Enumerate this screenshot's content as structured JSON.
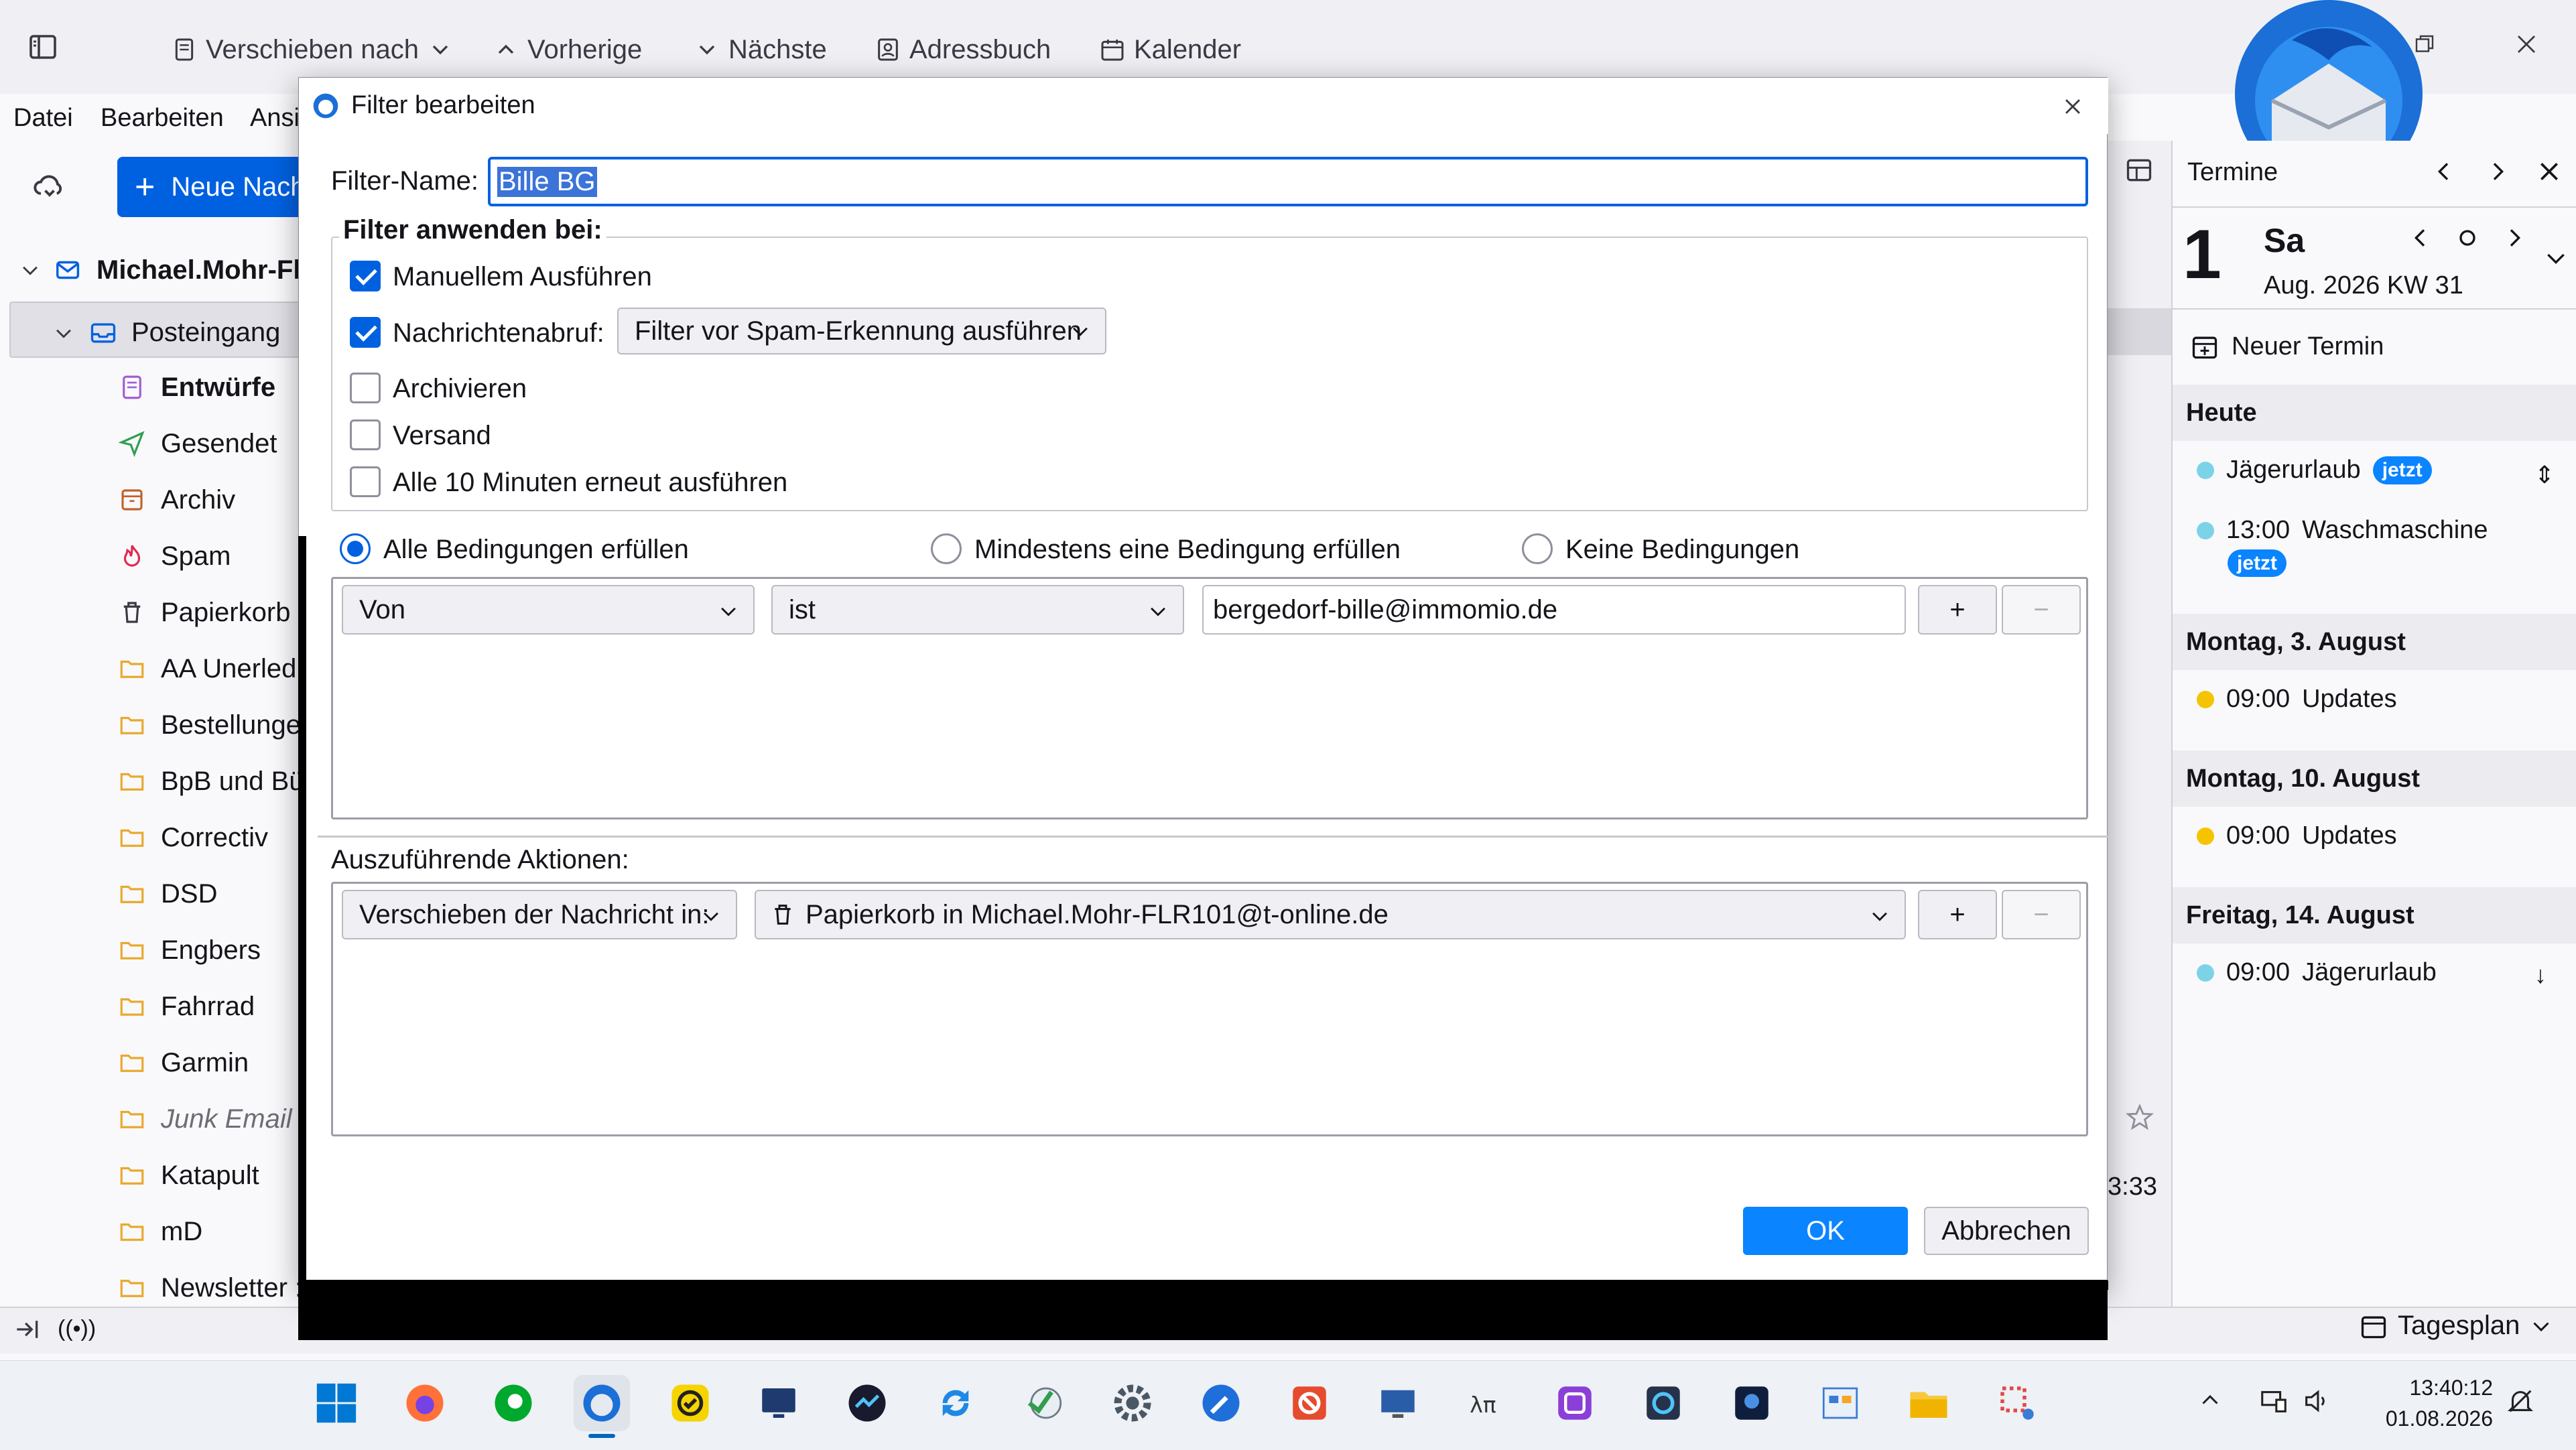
{
  "toolbar": {
    "move_to": "Verschieben nach",
    "previous": "Vorherige",
    "next": "Nächste",
    "addressbook": "Adressbuch",
    "calendar": "Kalender"
  },
  "menubar": {
    "file": "Datei",
    "edit": "Bearbeiten",
    "view": "Ansi"
  },
  "folderpane": {
    "new_message": "Neue Nach",
    "account": "Michael.Mohr-Fl",
    "inbox": "Posteingang",
    "folders": [
      "Entwürfe",
      "Gesendet",
      "Archiv",
      "Spam",
      "Papierkorb",
      "AA Unerled",
      "Bestellunge",
      "BpB und Bü",
      "Correctiv",
      "DSD",
      "Engbers",
      "Fahrrad",
      "Garmin",
      "Junk Email",
      "Katapult",
      "mD",
      "Newsletter :"
    ]
  },
  "msgpane": {
    "time_fragment": "3:33"
  },
  "calendar": {
    "title": "Termine",
    "day_number": "1",
    "weekday": "Sa",
    "date_line": "Aug. 2026 KW 31",
    "new_event": "Neuer Termin",
    "today_header": "Heute",
    "today_events": [
      {
        "time": "",
        "title": "Jägerurlaub",
        "badge": "jetzt"
      },
      {
        "time": "13:00",
        "title": "Waschmaschine",
        "badge": "jetzt"
      }
    ],
    "day2_header": "Montag, 3. August",
    "day2_event": {
      "time": "09:00",
      "title": "Updates"
    },
    "day3_header": "Montag, 10. August",
    "day3_event": {
      "time": "09:00",
      "title": "Updates"
    },
    "day4_header": "Freitag, 14. August",
    "day4_event": {
      "time": "09:00",
      "title": "Jägerurlaub"
    },
    "dayplan": "Tagesplan"
  },
  "dialog": {
    "title": "Filter bearbeiten",
    "filter_name_label": "Filter-Name:",
    "filter_name_value": "Bille BG",
    "apply_when_label": "Filter anwenden bei:",
    "manual_run": "Manuellem Ausführen",
    "on_fetch": "Nachrichtenabruf:",
    "on_fetch_select": "Filter vor Spam-Erkennung ausführen",
    "archive": "Archivieren",
    "send": "Versand",
    "periodic": "Alle 10 Minuten erneut ausführen",
    "match_all": "Alle Bedingungen erfüllen",
    "match_any": "Mindestens eine Bedingung erfüllen",
    "match_none": "Keine Bedingungen",
    "condition": {
      "field": "Von",
      "operator": "ist",
      "value": "bergedorf-bille@immomio.de"
    },
    "actions_label": "Auszuführende Aktionen:",
    "action": {
      "type": "Verschieben der Nachricht in:",
      "target": "Papierkorb in Michael.Mohr-FLR101@t-online.de"
    },
    "plus": "+",
    "minus": "−",
    "ok": "OK",
    "cancel": "Abbrechen"
  },
  "tray": {
    "time": "13:40:12",
    "date": "01.08.2026"
  },
  "colors": {
    "accent": "#0061e0",
    "ok_button": "#0a84ff",
    "event_cyan": "#7cd3e8",
    "event_yellow": "#f5c400"
  }
}
